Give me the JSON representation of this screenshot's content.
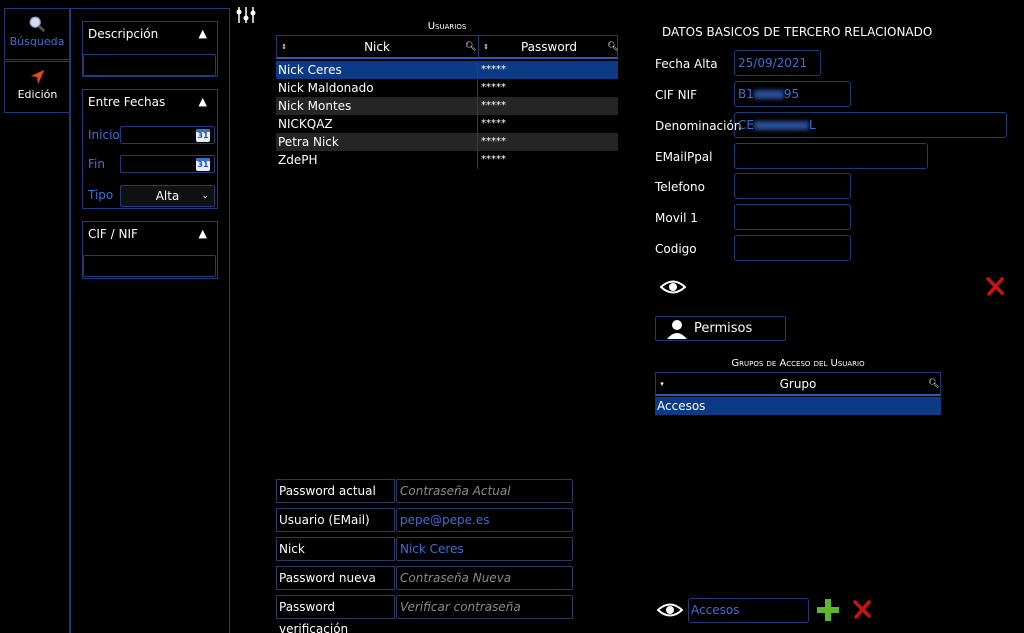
{
  "tabs": [
    {
      "label": "Búsqueda",
      "icon": "magnifier-icon"
    },
    {
      "label": "Edición",
      "icon": "arrow-pointer-icon"
    }
  ],
  "filters": {
    "descripcion": {
      "title": "Descripción",
      "value": ""
    },
    "fechas": {
      "title": "Entre Fechas",
      "inicio_label": "Inicio",
      "fin_label": "Fin",
      "tipo_label": "Tipo",
      "tipo_value": "Alta",
      "calendar_day": "31"
    },
    "cif": {
      "title": "CIF / NIF",
      "value": ""
    }
  },
  "usuarios": {
    "title": "Usuarios",
    "columns": [
      "Nick",
      "Password"
    ],
    "rows": [
      {
        "nick": "Nick Ceres",
        "password": "*****"
      },
      {
        "nick": "Nick Maldonado",
        "password": "*****"
      },
      {
        "nick": "Nick Montes",
        "password": "*****"
      },
      {
        "nick": "NICKQAZ",
        "password": "*****"
      },
      {
        "nick": "Petra Nick",
        "password": "*****"
      },
      {
        "nick": "ZdePH",
        "password": "*****"
      }
    ]
  },
  "form": {
    "password_actual": {
      "label": "Password actual",
      "placeholder": "Contraseña Actual",
      "value": ""
    },
    "usuario_email": {
      "label": "Usuario (EMail)",
      "value": "pepe@pepe.es"
    },
    "nick": {
      "label": "Nick",
      "value": "Nick Ceres"
    },
    "password_nueva": {
      "label": "Password nueva",
      "placeholder": "Contraseña Nueva",
      "value": ""
    },
    "password_verificacion": {
      "label": "Password verificación",
      "placeholder": "Verificar contraseña",
      "value": ""
    }
  },
  "tercero": {
    "title": "DATOS BASICOS DE TERCERO RELACIONADO",
    "fecha_alta": {
      "label": "Fecha Alta",
      "value": "25/09/2021"
    },
    "cif_nif": {
      "label": "CIF NIF",
      "value_prefix": "B1",
      "value_suffix": "95"
    },
    "denominacion": {
      "label": "Denominación",
      "value_prefix": "CE",
      "value_suffix": "L"
    },
    "email": {
      "label": "EMailPpal",
      "value": ""
    },
    "telefono": {
      "label": "Telefono",
      "value": ""
    },
    "movil": {
      "label": "Movil 1",
      "value": ""
    },
    "codigo": {
      "label": "Codigo",
      "value": ""
    }
  },
  "permisos_label": "Permisos",
  "grupos": {
    "title": "Grupos de Acceso del Usuario",
    "column": "Grupo",
    "rows": [
      "Accesos"
    ],
    "input_value": "Accesos"
  },
  "colors": {
    "accent": "#0d3a85",
    "border": "#1e3b7a",
    "link": "#3e6fd6",
    "add": "#5cb82a",
    "delete": "#d01010"
  }
}
